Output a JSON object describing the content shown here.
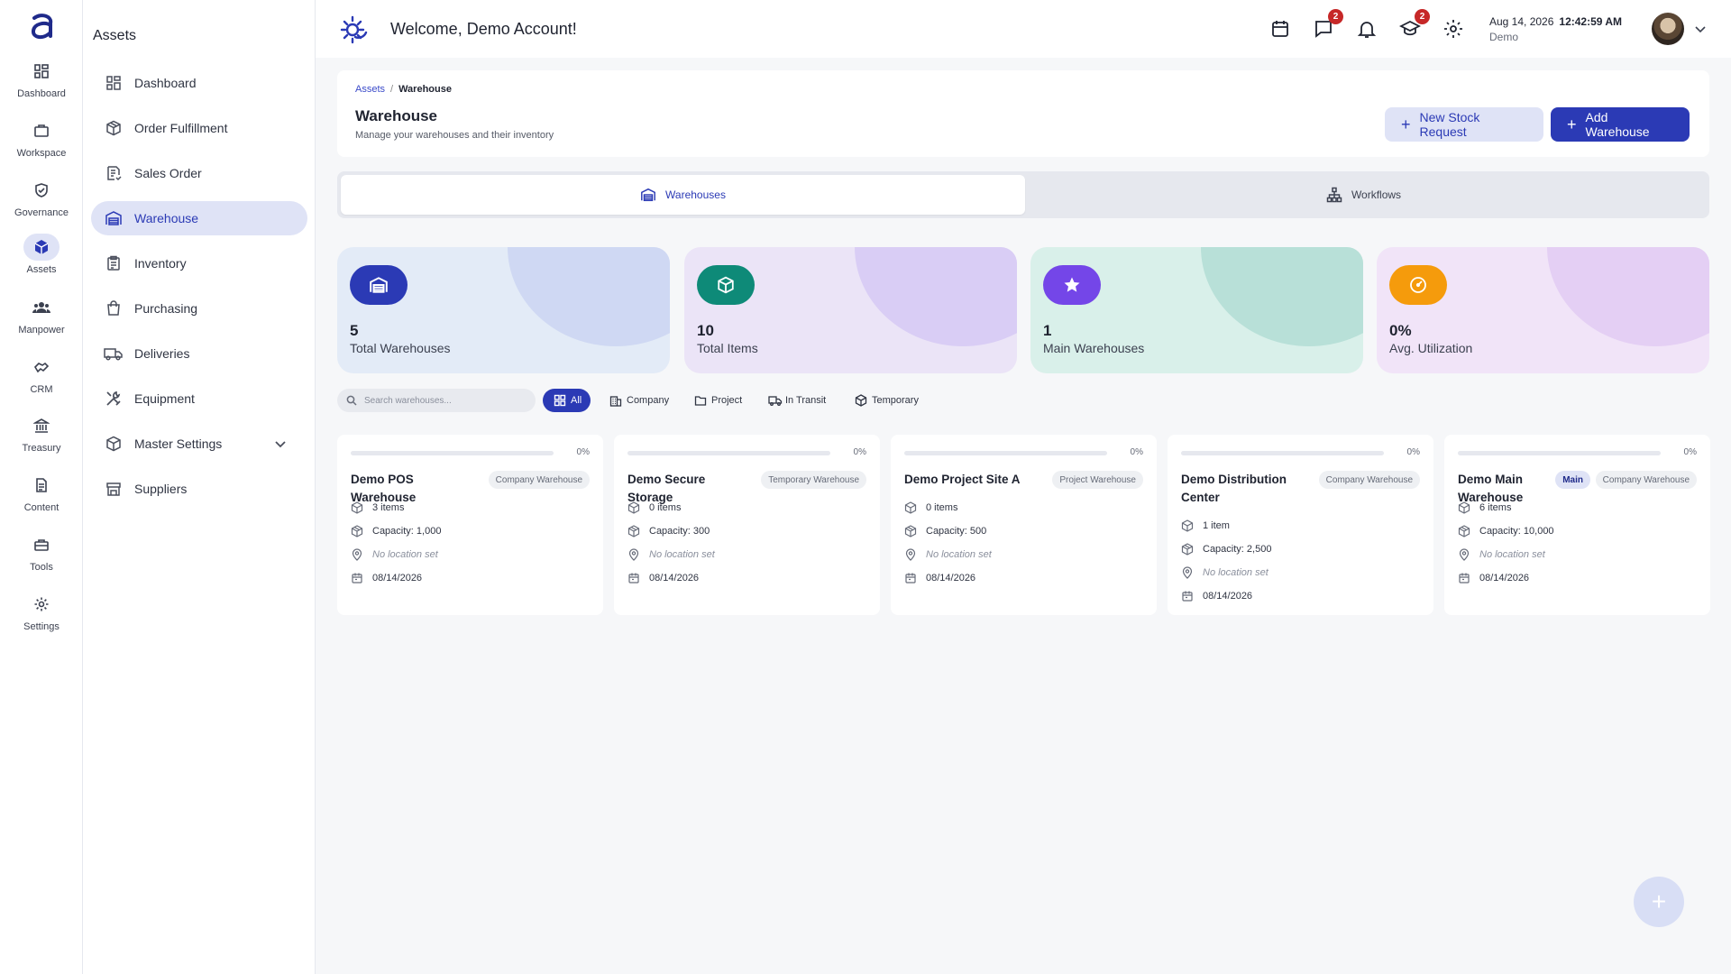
{
  "rail": {
    "items": [
      {
        "label": "Dashboard",
        "icon": "dashboard-icon"
      },
      {
        "label": "Workspace",
        "icon": "briefcase-icon"
      },
      {
        "label": "Governance",
        "icon": "shield-icon"
      },
      {
        "label": "Assets",
        "icon": "cube-icon"
      },
      {
        "label": "Manpower",
        "icon": "people-icon"
      },
      {
        "label": "CRM",
        "icon": "handshake-icon"
      },
      {
        "label": "Treasury",
        "icon": "bank-icon"
      },
      {
        "label": "Content",
        "icon": "document-icon"
      },
      {
        "label": "Tools",
        "icon": "toolbox-icon"
      },
      {
        "label": "Settings",
        "icon": "gear-icon"
      }
    ],
    "active": "Assets"
  },
  "sidebar": {
    "title": "Assets",
    "items": [
      {
        "label": "Dashboard",
        "icon": "grid-icon"
      },
      {
        "label": "Order Fulfillment",
        "icon": "package-icon"
      },
      {
        "label": "Sales Order",
        "icon": "receipt-icon"
      },
      {
        "label": "Warehouse",
        "icon": "warehouse-icon"
      },
      {
        "label": "Inventory",
        "icon": "clipboard-icon"
      },
      {
        "label": "Purchasing",
        "icon": "shopping-bag-icon"
      },
      {
        "label": "Deliveries",
        "icon": "truck-icon"
      },
      {
        "label": "Equipment",
        "icon": "tools-icon"
      },
      {
        "label": "Master Settings",
        "icon": "cube-icon"
      },
      {
        "label": "Suppliers",
        "icon": "store-icon"
      }
    ],
    "active": "Warehouse"
  },
  "topbar": {
    "welcome": "Welcome, Demo Account!",
    "messages_badge": "2",
    "learning_badge": "2",
    "date": "Aug 14, 2026",
    "time": "12:42:59 AM",
    "user": "Demo"
  },
  "page": {
    "breadcrumb": {
      "parent": "Assets",
      "separator": "/",
      "current": "Warehouse"
    },
    "title": "Warehouse",
    "subtitle": "Manage your warehouses and their inventory",
    "buttons": {
      "new_stock_request": "New Stock Request",
      "add_warehouse": "Add Warehouse"
    }
  },
  "tabs": [
    {
      "label": "Warehouses",
      "active": true
    },
    {
      "label": "Workflows",
      "active": false
    }
  ],
  "stats": [
    {
      "value": "5",
      "label": "Total Warehouses",
      "icon": "warehouse-icon",
      "bg": "#e3ebf7",
      "blob": "#cfd8f3",
      "icon_bg": "#2b3ab5"
    },
    {
      "value": "10",
      "label": "Total Items",
      "icon": "cube-icon",
      "bg": "#ebe4f7",
      "blob": "#d9cdf5",
      "icon_bg": "#0e8a78"
    },
    {
      "value": "1",
      "label": "Main Warehouses",
      "icon": "star-icon",
      "bg": "#d9f0ea",
      "blob": "#b8e0d8",
      "icon_bg": "#7446e8"
    },
    {
      "value": "0%",
      "label": "Avg. Utilization",
      "icon": "gauge-icon",
      "bg": "#f1e4f8",
      "blob": "#e4cff4",
      "icon_bg": "#f59b0c"
    }
  ],
  "filters": {
    "search_placeholder": "Search warehouses...",
    "chips": [
      {
        "label": "All",
        "icon": "grid-icon",
        "active": true
      },
      {
        "label": "Company",
        "icon": "building-icon",
        "active": false
      },
      {
        "label": "Project",
        "icon": "folder-icon",
        "active": false
      },
      {
        "label": "In Transit",
        "icon": "truck-icon",
        "active": false
      },
      {
        "label": "Temporary",
        "icon": "cube-icon",
        "active": false
      }
    ]
  },
  "warehouses": [
    {
      "name": "Demo POS Warehouse",
      "type": "Company Warehouse",
      "main": false,
      "utilization_pct": 0,
      "pct_label": "0%",
      "items": "3 items",
      "capacity": "Capacity: 1,000",
      "location": "No location set",
      "date": "08/14/2026"
    },
    {
      "name": "Demo Secure Storage",
      "type": "Temporary Warehouse",
      "main": false,
      "utilization_pct": 0,
      "pct_label": "0%",
      "items": "0 items",
      "capacity": "Capacity: 300",
      "location": "No location set",
      "date": "08/14/2026"
    },
    {
      "name": "Demo Project Site A",
      "type": "Project Warehouse",
      "main": false,
      "utilization_pct": 0,
      "pct_label": "0%",
      "items": "0 items",
      "capacity": "Capacity: 500",
      "location": "No location set",
      "date": "08/14/2026"
    },
    {
      "name": "Demo Distribution Center",
      "type": "Company Warehouse",
      "main": false,
      "utilization_pct": 0,
      "pct_label": "0%",
      "items": "1 item",
      "capacity": "Capacity: 2,500",
      "location": "No location set",
      "date": "08/14/2026"
    },
    {
      "name": "Demo Main Warehouse",
      "type": "Company Warehouse",
      "main": true,
      "main_label": "Main",
      "utilization_pct": 0,
      "pct_label": "0%",
      "items": "6 items",
      "capacity": "Capacity: 10,000",
      "location": "No location set",
      "date": "08/14/2026"
    }
  ],
  "colors": {
    "accent": "#2b3ab5",
    "accent_soft": "#dfe3f6",
    "badge": "#c62828"
  }
}
